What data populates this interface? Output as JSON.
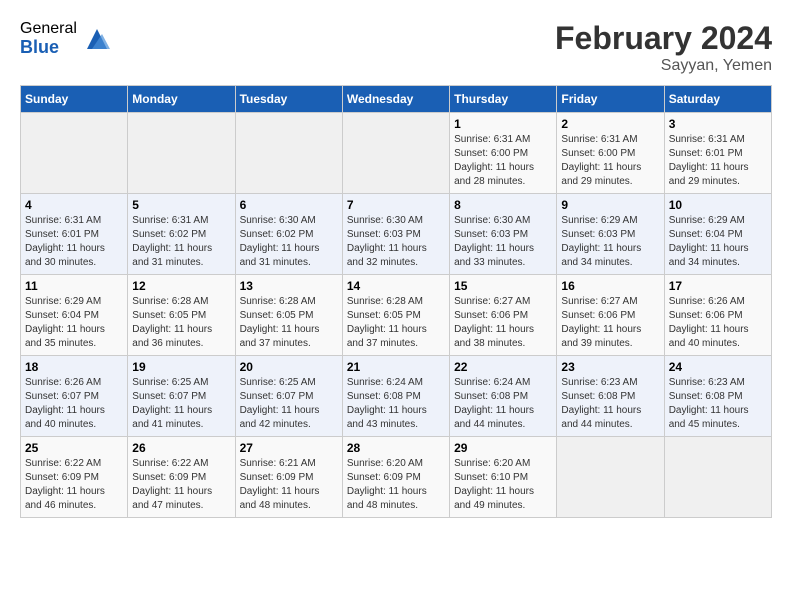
{
  "logo": {
    "general": "General",
    "blue": "Blue"
  },
  "title": "February 2024",
  "subtitle": "Sayyan, Yemen",
  "days_of_week": [
    "Sunday",
    "Monday",
    "Tuesday",
    "Wednesday",
    "Thursday",
    "Friday",
    "Saturday"
  ],
  "weeks": [
    [
      {
        "day": "",
        "detail": ""
      },
      {
        "day": "",
        "detail": ""
      },
      {
        "day": "",
        "detail": ""
      },
      {
        "day": "",
        "detail": ""
      },
      {
        "day": "1",
        "detail": "Sunrise: 6:31 AM\nSunset: 6:00 PM\nDaylight: 11 hours\nand 28 minutes."
      },
      {
        "day": "2",
        "detail": "Sunrise: 6:31 AM\nSunset: 6:00 PM\nDaylight: 11 hours\nand 29 minutes."
      },
      {
        "day": "3",
        "detail": "Sunrise: 6:31 AM\nSunset: 6:01 PM\nDaylight: 11 hours\nand 29 minutes."
      }
    ],
    [
      {
        "day": "4",
        "detail": "Sunrise: 6:31 AM\nSunset: 6:01 PM\nDaylight: 11 hours\nand 30 minutes."
      },
      {
        "day": "5",
        "detail": "Sunrise: 6:31 AM\nSunset: 6:02 PM\nDaylight: 11 hours\nand 31 minutes."
      },
      {
        "day": "6",
        "detail": "Sunrise: 6:30 AM\nSunset: 6:02 PM\nDaylight: 11 hours\nand 31 minutes."
      },
      {
        "day": "7",
        "detail": "Sunrise: 6:30 AM\nSunset: 6:03 PM\nDaylight: 11 hours\nand 32 minutes."
      },
      {
        "day": "8",
        "detail": "Sunrise: 6:30 AM\nSunset: 6:03 PM\nDaylight: 11 hours\nand 33 minutes."
      },
      {
        "day": "9",
        "detail": "Sunrise: 6:29 AM\nSunset: 6:03 PM\nDaylight: 11 hours\nand 34 minutes."
      },
      {
        "day": "10",
        "detail": "Sunrise: 6:29 AM\nSunset: 6:04 PM\nDaylight: 11 hours\nand 34 minutes."
      }
    ],
    [
      {
        "day": "11",
        "detail": "Sunrise: 6:29 AM\nSunset: 6:04 PM\nDaylight: 11 hours\nand 35 minutes."
      },
      {
        "day": "12",
        "detail": "Sunrise: 6:28 AM\nSunset: 6:05 PM\nDaylight: 11 hours\nand 36 minutes."
      },
      {
        "day": "13",
        "detail": "Sunrise: 6:28 AM\nSunset: 6:05 PM\nDaylight: 11 hours\nand 37 minutes."
      },
      {
        "day": "14",
        "detail": "Sunrise: 6:28 AM\nSunset: 6:05 PM\nDaylight: 11 hours\nand 37 minutes."
      },
      {
        "day": "15",
        "detail": "Sunrise: 6:27 AM\nSunset: 6:06 PM\nDaylight: 11 hours\nand 38 minutes."
      },
      {
        "day": "16",
        "detail": "Sunrise: 6:27 AM\nSunset: 6:06 PM\nDaylight: 11 hours\nand 39 minutes."
      },
      {
        "day": "17",
        "detail": "Sunrise: 6:26 AM\nSunset: 6:06 PM\nDaylight: 11 hours\nand 40 minutes."
      }
    ],
    [
      {
        "day": "18",
        "detail": "Sunrise: 6:26 AM\nSunset: 6:07 PM\nDaylight: 11 hours\nand 40 minutes."
      },
      {
        "day": "19",
        "detail": "Sunrise: 6:25 AM\nSunset: 6:07 PM\nDaylight: 11 hours\nand 41 minutes."
      },
      {
        "day": "20",
        "detail": "Sunrise: 6:25 AM\nSunset: 6:07 PM\nDaylight: 11 hours\nand 42 minutes."
      },
      {
        "day": "21",
        "detail": "Sunrise: 6:24 AM\nSunset: 6:08 PM\nDaylight: 11 hours\nand 43 minutes."
      },
      {
        "day": "22",
        "detail": "Sunrise: 6:24 AM\nSunset: 6:08 PM\nDaylight: 11 hours\nand 44 minutes."
      },
      {
        "day": "23",
        "detail": "Sunrise: 6:23 AM\nSunset: 6:08 PM\nDaylight: 11 hours\nand 44 minutes."
      },
      {
        "day": "24",
        "detail": "Sunrise: 6:23 AM\nSunset: 6:08 PM\nDaylight: 11 hours\nand 45 minutes."
      }
    ],
    [
      {
        "day": "25",
        "detail": "Sunrise: 6:22 AM\nSunset: 6:09 PM\nDaylight: 11 hours\nand 46 minutes."
      },
      {
        "day": "26",
        "detail": "Sunrise: 6:22 AM\nSunset: 6:09 PM\nDaylight: 11 hours\nand 47 minutes."
      },
      {
        "day": "27",
        "detail": "Sunrise: 6:21 AM\nSunset: 6:09 PM\nDaylight: 11 hours\nand 48 minutes."
      },
      {
        "day": "28",
        "detail": "Sunrise: 6:20 AM\nSunset: 6:09 PM\nDaylight: 11 hours\nand 48 minutes."
      },
      {
        "day": "29",
        "detail": "Sunrise: 6:20 AM\nSunset: 6:10 PM\nDaylight: 11 hours\nand 49 minutes."
      },
      {
        "day": "",
        "detail": ""
      },
      {
        "day": "",
        "detail": ""
      }
    ]
  ]
}
